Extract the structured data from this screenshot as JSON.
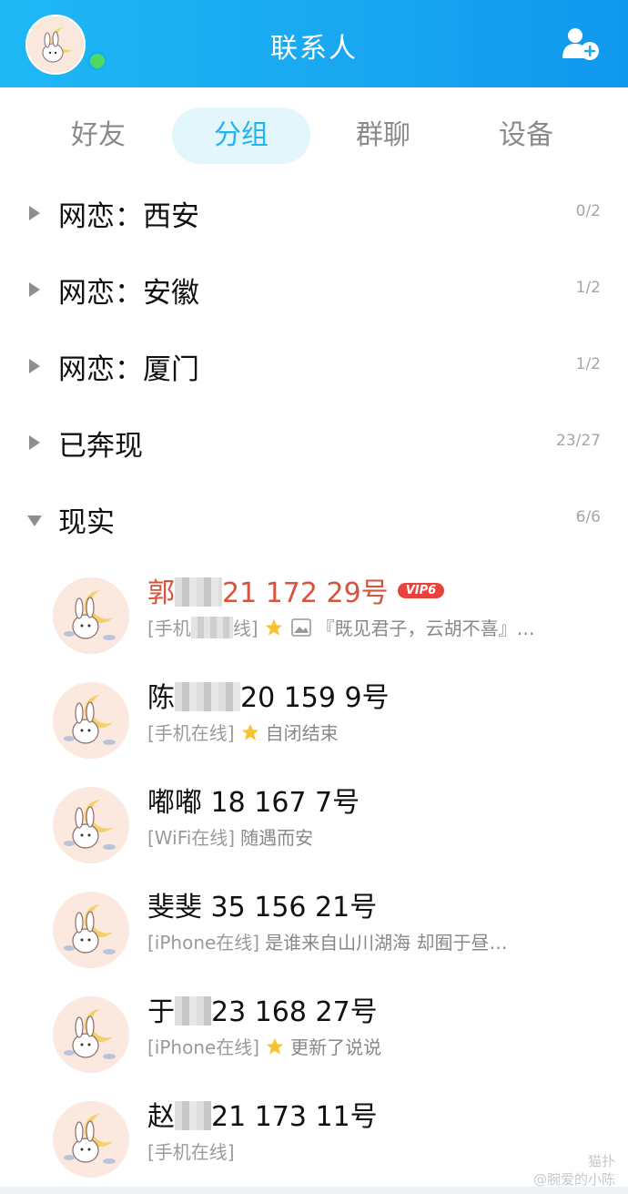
{
  "header": {
    "title": "联系人",
    "add_icon": "add-contact-icon",
    "online_color": "#4cd964"
  },
  "tabs": [
    {
      "label": "好友",
      "active": false
    },
    {
      "label": "分组",
      "active": true
    },
    {
      "label": "群聊",
      "active": false
    },
    {
      "label": "设备",
      "active": false
    }
  ],
  "groups": [
    {
      "name": "网恋：西安",
      "count": "0/2",
      "expanded": false
    },
    {
      "name": "网恋：安徽",
      "count": "1/2",
      "expanded": false
    },
    {
      "name": "网恋：厦门",
      "count": "1/2",
      "expanded": false
    },
    {
      "name": "已奔现",
      "count": "23/27",
      "expanded": false
    },
    {
      "name": "现实",
      "count": "6/6",
      "expanded": true
    }
  ],
  "contacts": [
    {
      "name_prefix": "郭",
      "name_suffix": "21 172 29号",
      "vip": "VIP6",
      "tag_prefix": "[手机",
      "tag_suffix": "线]",
      "signature": "『既见君子，云胡不喜』…"
    },
    {
      "name_prefix": "陈",
      "name_suffix": "20 159 9号",
      "tag": "[手机在线]",
      "signature": "自闭结束"
    },
    {
      "name": "嘟嘟 18 167 7号",
      "tag": "[WiFi在线]",
      "signature": "随遇而安"
    },
    {
      "name": "斐斐 35 156 21号",
      "tag": "[iPhone在线]",
      "signature": "是谁来自山川湖海  却囿于昼…"
    },
    {
      "name_prefix": "于",
      "name_suffix": "23 168 27号",
      "tag": "[iPhone在线]",
      "signature": "更新了说说"
    },
    {
      "name_prefix": "赵",
      "name_suffix": "21 173 11号",
      "tag": "[手机在线]"
    }
  ],
  "watermark": {
    "line1": "猫扑",
    "line2": "@腕爱的小陈"
  },
  "colors": {
    "header": "#19aef2",
    "accent": "#22b4ee",
    "vip": "#e9413b",
    "vip_name": "#d7533c"
  }
}
